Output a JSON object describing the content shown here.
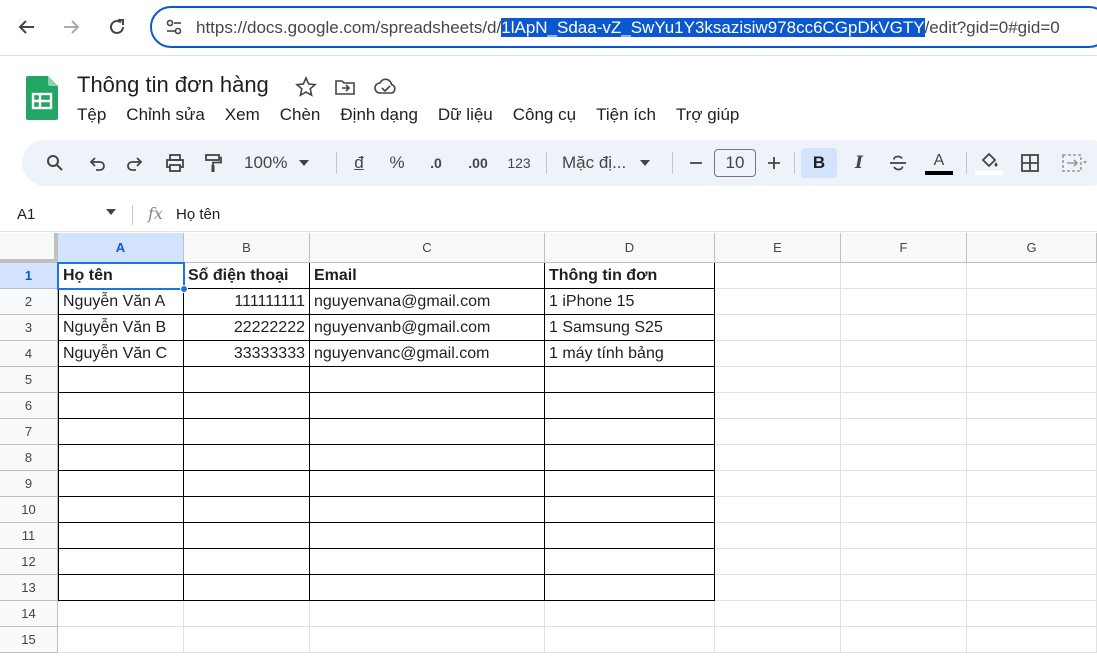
{
  "browser": {
    "url_prefix": "https://docs.google.com/spreadsheets/d/",
    "url_selected": "1lApN_Sdaa-vZ_SwYu1Y3ksazisiw978cc6CGpDkVGTY",
    "url_suffix": "/edit?gid=0#gid=0"
  },
  "doc": {
    "title": "Thông tin đơn hàng"
  },
  "menu": [
    "Tệp",
    "Chỉnh sửa",
    "Xem",
    "Chèn",
    "Định dạng",
    "Dữ liệu",
    "Công cụ",
    "Tiện ích",
    "Trợ giúp"
  ],
  "toolbar": {
    "zoom": "100%",
    "currency": "đ",
    "percent": "%",
    "decrease_decimal": ".0",
    "increase_decimal": ".00",
    "number_format": "123",
    "font": "Mặc đị...",
    "font_size": "10",
    "bold": "B",
    "italic": "I",
    "text_color": "A"
  },
  "formula_bar": {
    "cell_ref": "A1",
    "fx": "fx",
    "value": "Họ tên"
  },
  "sheet": {
    "columns": [
      "A",
      "B",
      "C",
      "D",
      "E",
      "F",
      "G"
    ],
    "row_numbers": [
      "1",
      "2",
      "3",
      "4",
      "5",
      "6",
      "7",
      "8",
      "9",
      "10",
      "11",
      "12",
      "13",
      "14",
      "15"
    ],
    "rows": [
      [
        "Họ tên",
        "Số điện thoại",
        "Email",
        "Thông tin đơn"
      ],
      [
        "Nguyễn Văn A",
        "111111111",
        "nguyenvana@gmail.com",
        "1 iPhone 15"
      ],
      [
        "Nguyễn Văn B",
        "22222222",
        "nguyenvanb@gmail.com",
        "1 Samsung S25"
      ],
      [
        "Nguyễn Văn C",
        "33333333",
        "nguyenvanc@gmail.com",
        "1 máy tính bảng"
      ]
    ],
    "active_cell": "A1"
  }
}
